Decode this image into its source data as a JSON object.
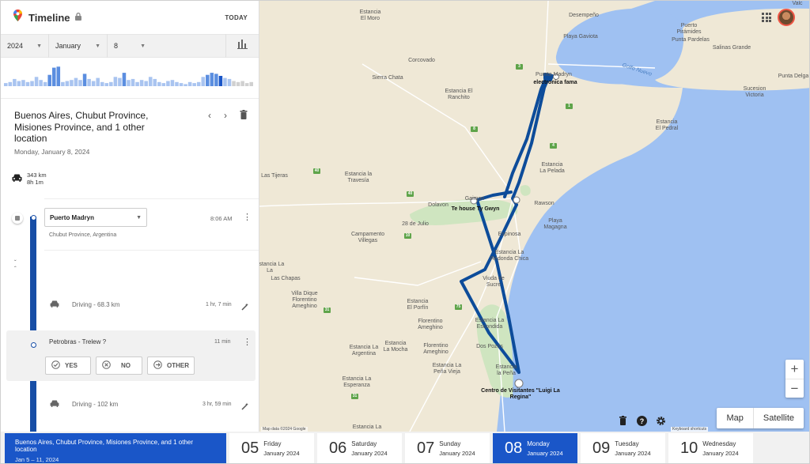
{
  "app": {
    "title": "Timeline",
    "today_label": "TODAY"
  },
  "filters": {
    "year": "2024",
    "month": "January",
    "day": "8"
  },
  "histogram": [
    {
      "v": 0.15,
      "c": "#a9c4f0"
    },
    {
      "v": 0.2,
      "c": "#a9c4f0"
    },
    {
      "v": 0.35,
      "c": "#a9c4f0"
    },
    {
      "v": 0.25,
      "c": "#a9c4f0"
    },
    {
      "v": 0.3,
      "c": "#a9c4f0"
    },
    {
      "v": 0.2,
      "c": "#a9c4f0"
    },
    {
      "v": 0.25,
      "c": "#a9c4f0"
    },
    {
      "v": 0.45,
      "c": "#a9c4f0"
    },
    {
      "v": 0.3,
      "c": "#a9c4f0"
    },
    {
      "v": 0.2,
      "c": "#a9c4f0"
    },
    {
      "v": 0.55,
      "c": "#5b8ee0"
    },
    {
      "v": 0.9,
      "c": "#5b8ee0"
    },
    {
      "v": 0.95,
      "c": "#5b8ee0"
    },
    {
      "v": 0.2,
      "c": "#a9c4f0"
    },
    {
      "v": 0.25,
      "c": "#a9c4f0"
    },
    {
      "v": 0.3,
      "c": "#a9c4f0"
    },
    {
      "v": 0.4,
      "c": "#a9c4f0"
    },
    {
      "v": 0.3,
      "c": "#a9c4f0"
    },
    {
      "v": 0.6,
      "c": "#5b8ee0"
    },
    {
      "v": 0.35,
      "c": "#a9c4f0"
    },
    {
      "v": 0.25,
      "c": "#a9c4f0"
    },
    {
      "v": 0.4,
      "c": "#a9c4f0"
    },
    {
      "v": 0.2,
      "c": "#a9c4f0"
    },
    {
      "v": 0.15,
      "c": "#a9c4f0"
    },
    {
      "v": 0.2,
      "c": "#a9c4f0"
    },
    {
      "v": 0.45,
      "c": "#a9c4f0"
    },
    {
      "v": 0.4,
      "c": "#a9c4f0"
    },
    {
      "v": 0.65,
      "c": "#5b8ee0"
    },
    {
      "v": 0.3,
      "c": "#a9c4f0"
    },
    {
      "v": 0.35,
      "c": "#a9c4f0"
    },
    {
      "v": 0.2,
      "c": "#a9c4f0"
    },
    {
      "v": 0.3,
      "c": "#a9c4f0"
    },
    {
      "v": 0.25,
      "c": "#a9c4f0"
    },
    {
      "v": 0.45,
      "c": "#a9c4f0"
    },
    {
      "v": 0.35,
      "c": "#a9c4f0"
    },
    {
      "v": 0.2,
      "c": "#a9c4f0"
    },
    {
      "v": 0.15,
      "c": "#a9c4f0"
    },
    {
      "v": 0.25,
      "c": "#a9c4f0"
    },
    {
      "v": 0.3,
      "c": "#a9c4f0"
    },
    {
      "v": 0.2,
      "c": "#a9c4f0"
    },
    {
      "v": 0.15,
      "c": "#a9c4f0"
    },
    {
      "v": 0.1,
      "c": "#a9c4f0"
    },
    {
      "v": 0.2,
      "c": "#a9c4f0"
    },
    {
      "v": 0.15,
      "c": "#a9c4f0"
    },
    {
      "v": 0.2,
      "c": "#a9c4f0"
    },
    {
      "v": 0.45,
      "c": "#a9c4f0"
    },
    {
      "v": 0.55,
      "c": "#5b8ee0"
    },
    {
      "v": 0.65,
      "c": "#5b8ee0"
    },
    {
      "v": 0.6,
      "c": "#5b8ee0"
    },
    {
      "v": 0.5,
      "c": "#1a56c8"
    },
    {
      "v": 0.4,
      "c": "#a9c4f0"
    },
    {
      "v": 0.35,
      "c": "#a9c4f0"
    },
    {
      "v": 0.25,
      "c": "#d0d0d0"
    },
    {
      "v": 0.2,
      "c": "#d0d0d0"
    },
    {
      "v": 0.25,
      "c": "#d0d0d0"
    },
    {
      "v": 0.15,
      "c": "#d0d0d0"
    },
    {
      "v": 0.2,
      "c": "#d0d0d0"
    }
  ],
  "day": {
    "title": "Buenos Aires, Chubut Province, Misiones Province, and 1 other location",
    "date": "Monday, January 8, 2024",
    "distance": "343 km",
    "duration": "8h 1m"
  },
  "timeline": {
    "place1": {
      "name": "Puerto Madryn",
      "time": "8:06 AM",
      "address": "Chubut Province, Argentina"
    },
    "drive1": {
      "label": "Driving - 68.3 km",
      "duration": "1 hr, 7 min"
    },
    "visit": {
      "name": "Petrobras - Trelew ?",
      "duration": "11 min",
      "yes": "YES",
      "no": "NO",
      "other": "OTHER"
    },
    "drive2": {
      "label": "Driving - 102 km",
      "duration": "3 hr, 59 min"
    }
  },
  "map": {
    "labels": {
      "el_moro": "Estancia\nEl Moro",
      "desemp": "Desempeño",
      "valdes": "Valc",
      "gaviota": "Playa Gaviota",
      "corcovado": "Corcovado",
      "sierra_chata": "Sierra Chata",
      "pmadryn": "Puerto Madryn",
      "fama": "electronica fama",
      "golfo": "Golfo Nuevo",
      "piramides": "Puerto\nPirámides",
      "pardelas": "Punta Pardelas",
      "salinas": "Salinas Grande",
      "delgada": "Punta Delga",
      "sucesion": "Sucesion\nVictoria",
      "ranchito": "Estancia El\nRanchito",
      "pedral": "Estancia\nEl Pedral",
      "lapelada": "Estancia\nLa Pelada",
      "tijeras": "Las Tijeras",
      "travesia": "Estancia la\nTravesía",
      "gaiman": "Gaiman",
      "tygwyn": "Te house Ty Gwyn",
      "dolavon": "Dolavon",
      "rawson": "Rawson",
      "magagna": "Playa\nMagagna",
      "julio": "28 de Julio",
      "villegas": "Campamento\nVillegas",
      "espinosa": "Espinosa",
      "redonda": "Estancia La\nRedonda Chica",
      "lala": "Estancia La\nLa",
      "chapas": "Las Chapas",
      "dique": "Villa Dique\nFlorentino\nAmeghino",
      "sucre": "Viuda de\nSucre",
      "porfin": "Estancia\nEl Porfín",
      "fameghino": "Florentino\nAmeghino",
      "escondida": "Estancia La\nEscondida",
      "argentina": "Estancia La\nArgentina",
      "mocha": "Estancia\nLa Mocha",
      "fameghino2": "Florentino\nAmeghino",
      "dospozos": "Dos Pozos",
      "penavieja": "Estancia La\nPeña Vieja",
      "lapena": "Estancia\nla Peña",
      "esperanza": "Estancia La\nEsperanza",
      "visitantes": "Centro de Visitantes \"Luigi La\nRegina\"",
      "la_bottom": "Estancia La"
    },
    "map_button": "Map",
    "satellite_button": "Satellite",
    "zoom_in": "+",
    "zoom_out": "−",
    "attribution": "Map data ©2024 Google",
    "shortcuts": "Keyboard shortcuts",
    "route_color": "#0d4c9a"
  },
  "strip": {
    "range_title": "Buenos Aires, Chubut Province, Misiones Province, and 1 other location",
    "range_dates": "Jan 5 – 11, 2024",
    "days": [
      {
        "num": "05",
        "weekday": "Friday",
        "month": "January 2024"
      },
      {
        "num": "06",
        "weekday": "Saturday",
        "month": "January 2024"
      },
      {
        "num": "07",
        "weekday": "Sunday",
        "month": "January 2024"
      },
      {
        "num": "08",
        "weekday": "Monday",
        "month": "January 2024"
      },
      {
        "num": "09",
        "weekday": "Tuesday",
        "month": "January 2024"
      },
      {
        "num": "10",
        "weekday": "Wednesday",
        "month": "January 2024"
      }
    ]
  }
}
